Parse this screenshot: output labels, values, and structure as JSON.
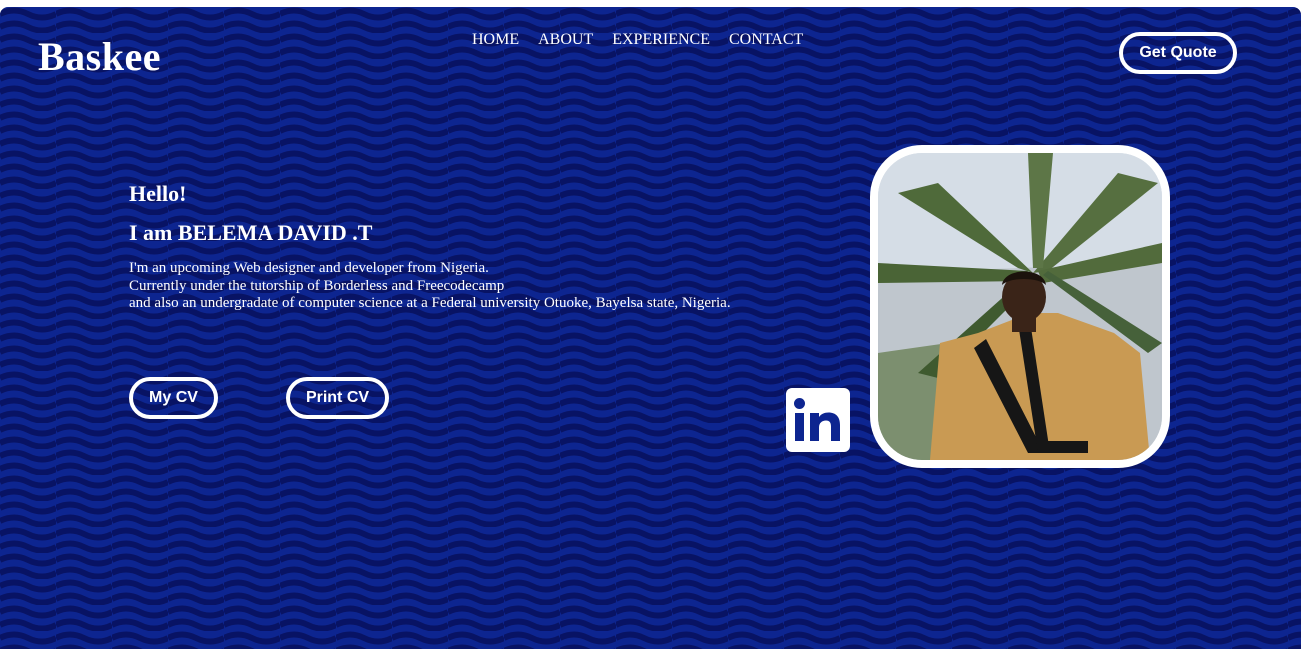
{
  "brand": {
    "name": "Baskee"
  },
  "nav": {
    "items": [
      {
        "label": "HOME"
      },
      {
        "label": "ABOUT"
      },
      {
        "label": "EXPERIENCE"
      },
      {
        "label": "CONTACT"
      }
    ]
  },
  "header": {
    "cta_label": "Get Quote"
  },
  "hero": {
    "greeting": "Hello!",
    "intro": "I am BELEMA DAVID .T",
    "bio_lines": [
      "I'm an upcoming Web designer and developer from Nigeria.",
      "Currently under the tutorship of Borderless and Freecodecamp",
      "and also an undergradate of computer science at a Federal university Otuoke, Bayelsa state, Nigeria."
    ],
    "buttons": {
      "cv_label": "My CV",
      "print_label": "Print CV"
    }
  },
  "social": {
    "linkedin_icon": "linkedin-icon"
  },
  "photo": {
    "alt": "Portrait photo"
  },
  "colors": {
    "background": "#0d2590",
    "wave": "#0a1466",
    "text": "#ffffff",
    "linkedin_blue": "#0d2590"
  }
}
